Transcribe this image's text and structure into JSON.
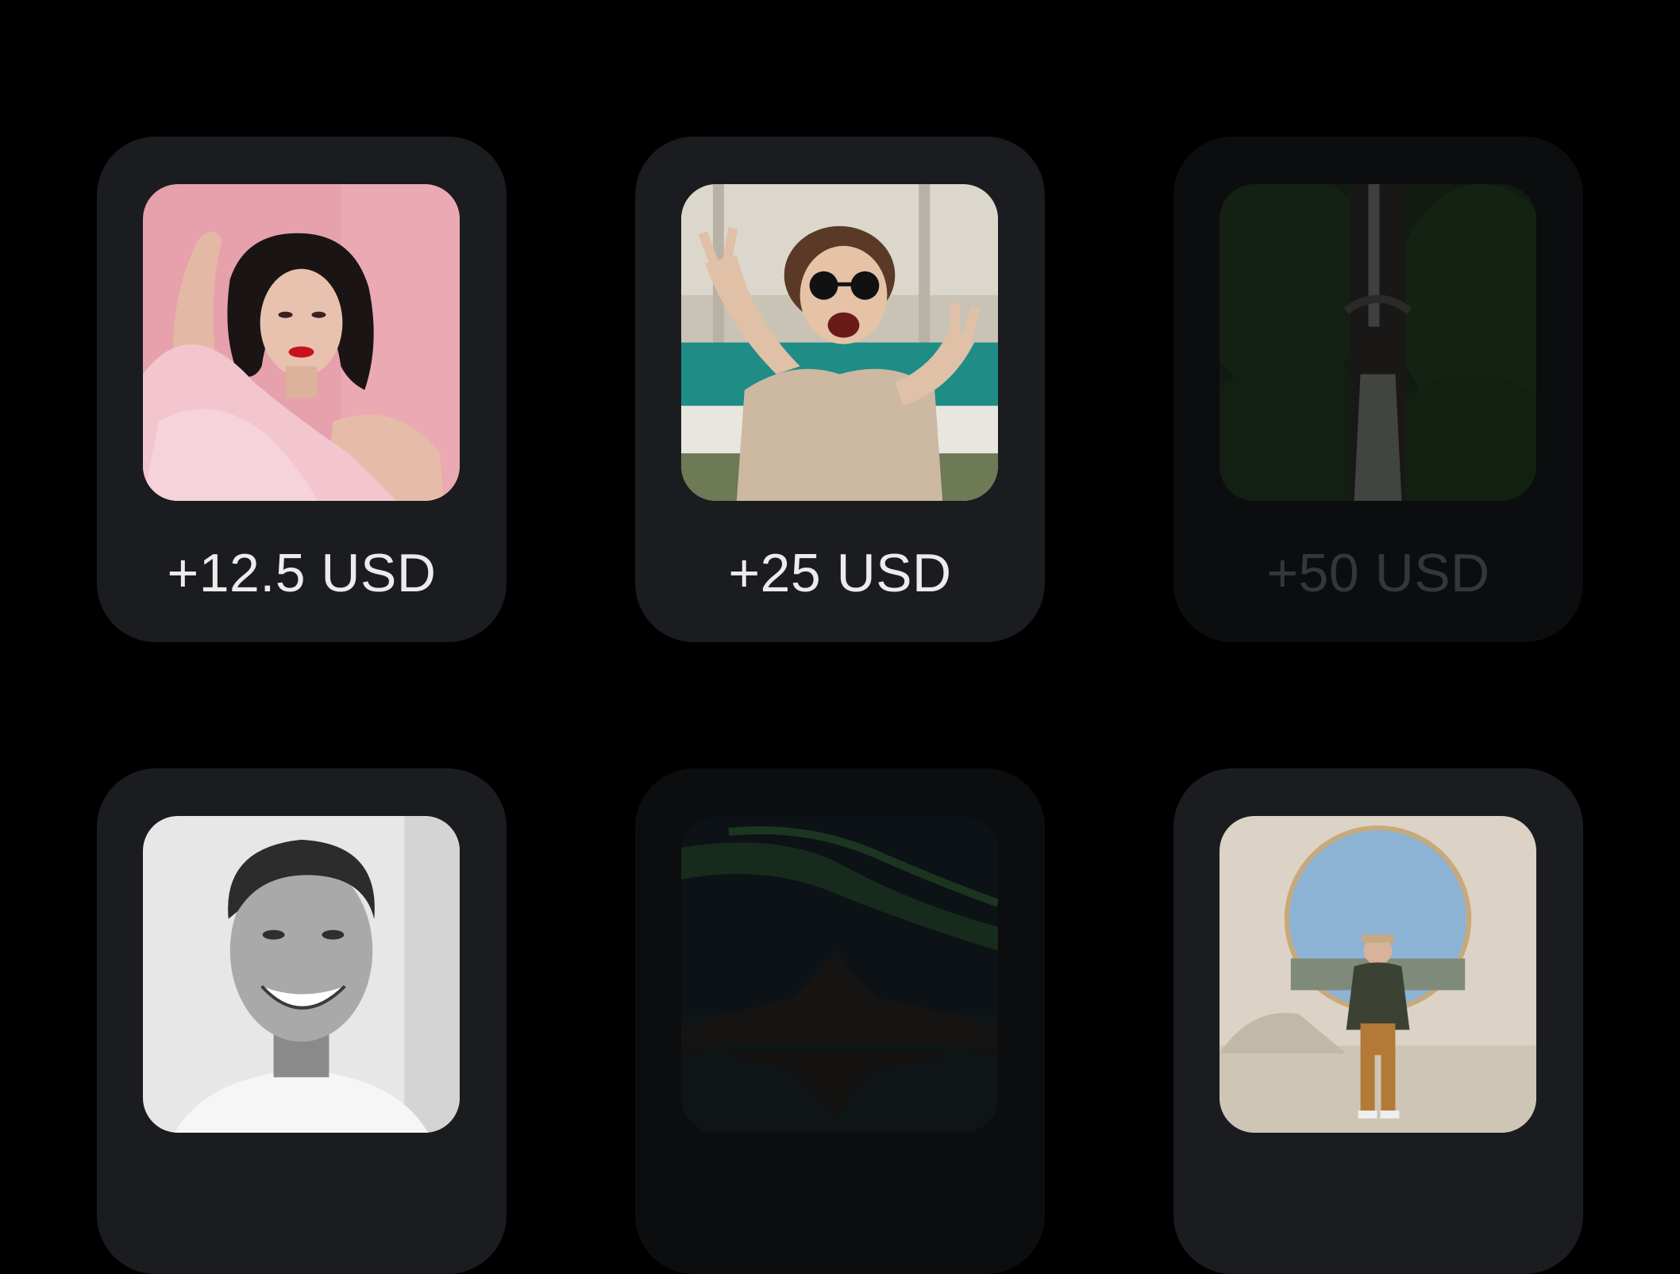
{
  "tiers": [
    {
      "price": "+12.5 USD",
      "photo_icon": "portrait-pink-background-icon",
      "available": true
    },
    {
      "price": "+25 USD",
      "photo_icon": "portrait-sunglasses-peace-sign-icon",
      "available": true
    },
    {
      "price": "+50 USD",
      "photo_icon": "waterfall-forest-icon",
      "available": false
    },
    {
      "price": "",
      "photo_icon": "portrait-smiling-man-icon",
      "available": true
    },
    {
      "price": "",
      "photo_icon": "aurora-mountain-night-icon",
      "available": false
    },
    {
      "price": "",
      "photo_icon": "person-sitting-circle-wall-icon",
      "available": true
    }
  ],
  "colors": {
    "background": "#000000",
    "card": "#1a1c1f",
    "card_disabled": "#0c0d0e",
    "price_text": "#ececec",
    "price_text_disabled": "#34373a"
  }
}
